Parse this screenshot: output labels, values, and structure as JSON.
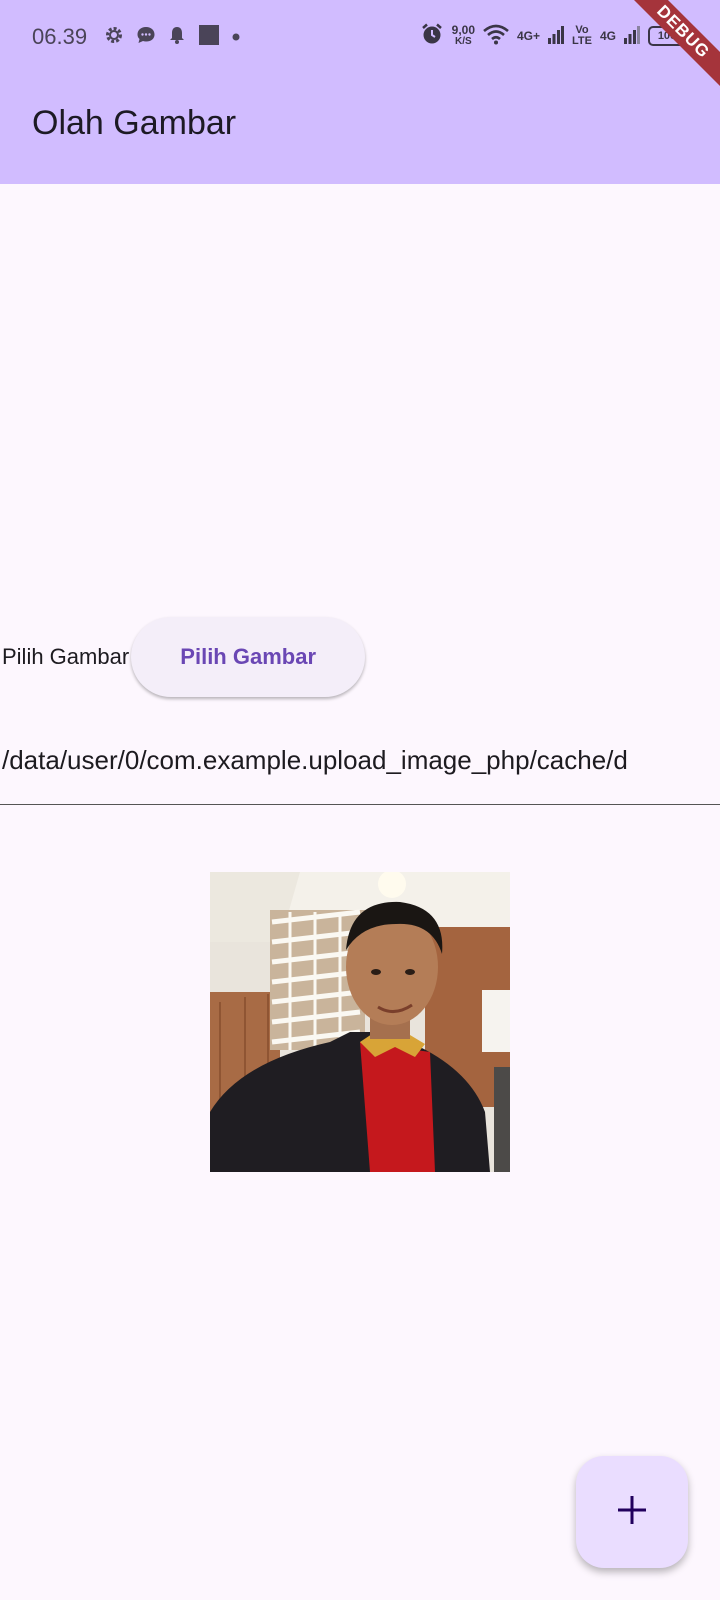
{
  "status_bar": {
    "time": "06.39",
    "net_speed_value": "9,00",
    "net_speed_unit": "K/S",
    "network_1": "4G+",
    "volte_top": "Vo",
    "volte_bottom": "LTE",
    "network_2": "4G",
    "battery": "100",
    "left_icons": [
      "settings-gear-icon",
      "message-bubble-icon",
      "bell-icon",
      "square-notification-icon",
      "dot-icon"
    ],
    "right_icons": [
      "alarm-icon",
      "wifi-icon",
      "signal-bars-icon",
      "signal-bars-icon",
      "battery-icon"
    ]
  },
  "debug_banner": "DEBUG",
  "app_bar": {
    "title": "Olah Gambar"
  },
  "picker": {
    "label": "Pilih Gambar",
    "button_label": "Pilih Gambar"
  },
  "path_field": {
    "value": "/data/user/0/com.example.upload_image_php/cache/d"
  },
  "fab": {
    "icon": "plus-icon"
  },
  "colors": {
    "app_bar": "#d1bcff",
    "background": "#fdf7fe",
    "button_text": "#6a47b4",
    "fab_background": "#eaddff"
  }
}
